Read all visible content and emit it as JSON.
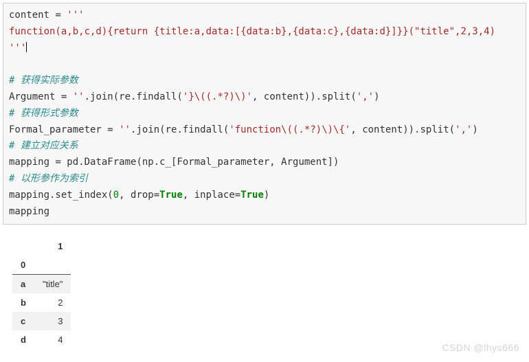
{
  "code": {
    "l1a": "content ",
    "l1b": "=",
    "l1c": " '''",
    "l2": "function(a,b,c,d){return {title:a,data:[{data:b},{data:c},{data:d}]}}(\"title\",2,3,4)",
    "l3": "'''",
    "blank": "",
    "c1": "# 获得实际参数",
    "l4a": "Argument ",
    "l4b": "=",
    "l4c": " ''",
    "l4d": ".join(re.findall(",
    "l4e": "'}\\((.*?)\\)'",
    "l4f": ", content)).split(",
    "l4g": "','",
    "l4h": ")",
    "c2": "# 获得形式参数",
    "l5a": "Formal_parameter ",
    "l5b": "=",
    "l5c": " ''",
    "l5d": ".join(re.findall(",
    "l5e": "'function\\((.*?)\\)\\{'",
    "l5f": ", content)).split(",
    "l5g": "','",
    "l5h": ")",
    "c3": "# 建立对应关系",
    "l6a": "mapping ",
    "l6b": "=",
    "l6c": " pd.DataFrame(np.c_[Formal_parameter, Argument])",
    "c4": "# 以形参作为索引",
    "l7a": "mapping.set_index(",
    "l7b": "0",
    "l7c": ", drop",
    "l7d": "=",
    "l7e": "True",
    "l7f": ", inplace",
    "l7g": "=",
    "l7h": "True",
    "l7i": ")",
    "l8": "mapping"
  },
  "table": {
    "col": "1",
    "idx": "0",
    "rows": [
      {
        "k": "a",
        "v": "\"title\""
      },
      {
        "k": "b",
        "v": "2"
      },
      {
        "k": "c",
        "v": "3"
      },
      {
        "k": "d",
        "v": "4"
      }
    ]
  },
  "watermark": "CSDN @lhys666"
}
